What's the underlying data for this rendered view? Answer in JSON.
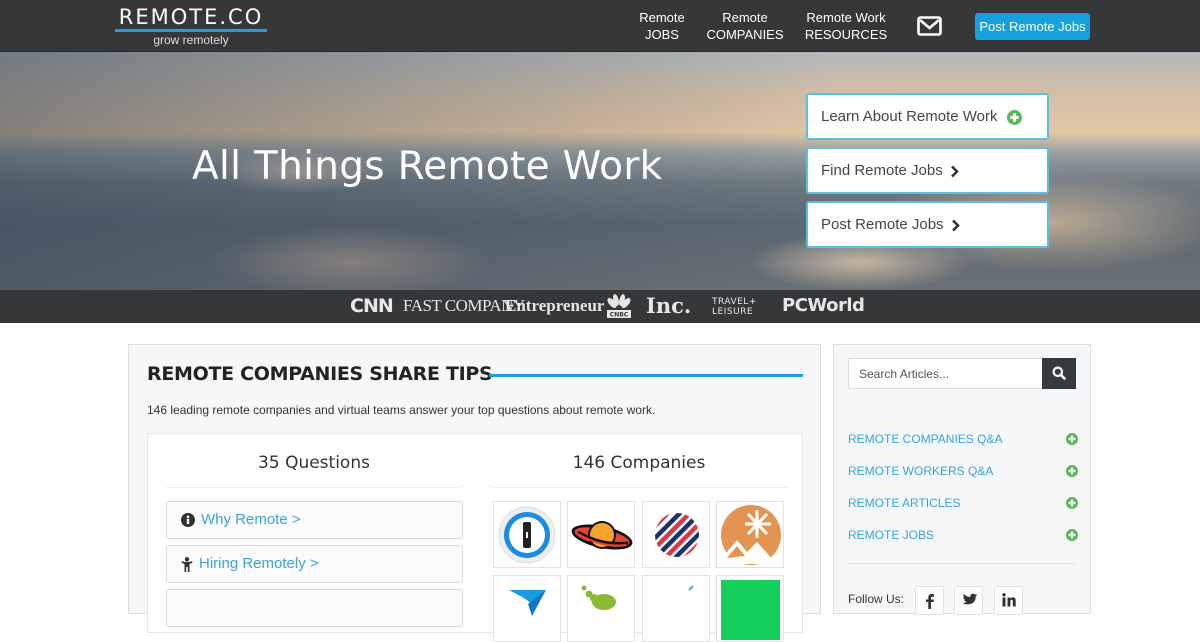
{
  "header": {
    "logo_text": "REMOTE.CO",
    "tagline": "grow remotely",
    "nav": [
      {
        "line1": "Remote",
        "line2": "JOBS"
      },
      {
        "line1": "Remote",
        "line2": "COMPANIES"
      },
      {
        "line1": "Remote Work",
        "line2": "RESOURCES"
      }
    ],
    "mail_icon": "envelope-icon",
    "post_button": "Post Remote Jobs",
    "accent_color": "#15a0e0"
  },
  "hero": {
    "title": "All Things Remote Work",
    "buttons": [
      {
        "label": "Learn About Remote Work",
        "icon": "plus-circle-icon"
      },
      {
        "label": "Find Remote Jobs",
        "icon": "chevron-right-icon"
      },
      {
        "label": "Post Remote Jobs",
        "icon": "chevron-right-icon"
      }
    ]
  },
  "press": {
    "logos": [
      "CNN",
      "FAST COMPANY",
      "Entrepreneur",
      "CNBC",
      "Inc.",
      "TRAVEL+",
      "LEISURE",
      "PCWorld"
    ]
  },
  "main": {
    "section_title": "REMOTE COMPANIES SHARE TIPS",
    "description": "146 leading remote companies and virtual teams answer your top questions about remote work.",
    "questions_heading": "35 Questions",
    "companies_heading": "146 Companies",
    "question_items": [
      {
        "label": "Why Remote >",
        "icon": "info-circle-icon"
      },
      {
        "label": "Hiring Remotely >",
        "icon": "person-icon"
      },
      {
        "label": "",
        "icon": ""
      }
    ],
    "company_logos": [
      "1password-logo",
      "saturn-logo",
      "striped-circle-logo",
      "snowflake-mountain-logo",
      "paper-plane-logo",
      "green-dots-logo",
      "blank-logo",
      "green-square-logo"
    ]
  },
  "sidebar": {
    "search_placeholder": "Search Articles...",
    "search_icon": "magnifier-icon",
    "links": [
      {
        "label": "REMOTE COMPANIES Q&A"
      },
      {
        "label": "REMOTE WORKERS Q&A"
      },
      {
        "label": "REMOTE ARTICLES"
      },
      {
        "label": "REMOTE JOBS"
      }
    ],
    "follow_label": "Follow Us:",
    "social": [
      "facebook",
      "twitter",
      "linkedin"
    ],
    "link_color": "#3aa3d9",
    "plus_color": "#5cb85c"
  }
}
